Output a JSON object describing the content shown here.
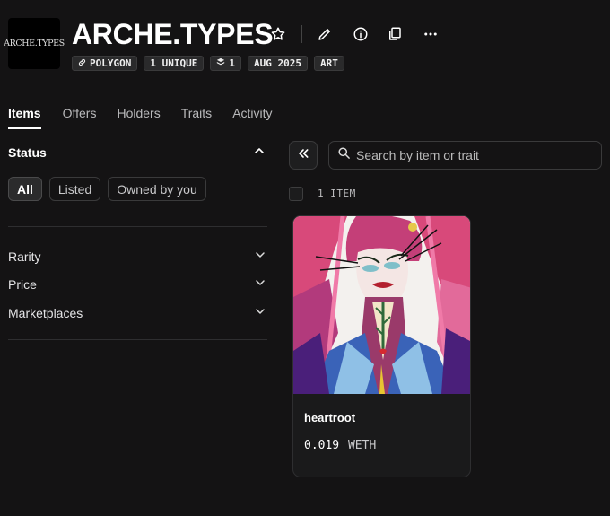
{
  "collection": {
    "logo_text": "ARCHE.TYPES",
    "title": "ARCHE.TYPES",
    "badges": [
      {
        "label": "POLYGON",
        "icon": "link-icon"
      },
      {
        "label": "1 UNIQUE"
      },
      {
        "label": "1",
        "icon": "layers-icon"
      },
      {
        "label": "AUG 2025"
      },
      {
        "label": "ART"
      }
    ]
  },
  "header_icons": [
    "star-icon",
    "pencil-icon",
    "info-icon",
    "copy-icon",
    "more-icon"
  ],
  "tabs": [
    "Items",
    "Offers",
    "Holders",
    "Traits",
    "Activity"
  ],
  "filters": {
    "status_title": "Status",
    "status_options": [
      "All",
      "Listed",
      "Owned by you"
    ],
    "sections": [
      "Rarity",
      "Price",
      "Marketplaces"
    ]
  },
  "search": {
    "placeholder": "Search by item or trait"
  },
  "results": {
    "count_label": "1 ITEM"
  },
  "items": [
    {
      "name": "heartroot",
      "price": "0.019",
      "currency": "WETH"
    }
  ],
  "colors": {
    "background": "#141314",
    "panel_border": "#3a3a3b",
    "text_muted": "#b9b9bb"
  }
}
